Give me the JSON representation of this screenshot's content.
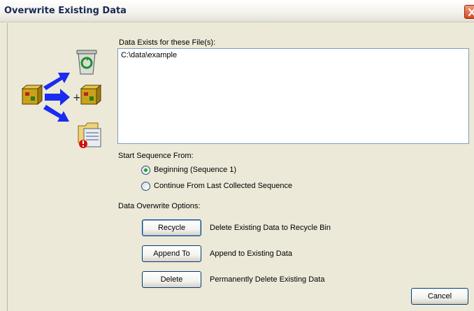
{
  "window": {
    "title": "Overwrite Existing Data"
  },
  "files": {
    "label": "Data Exists for these File(s):",
    "items": [
      "C:\\data\\example"
    ]
  },
  "sequence": {
    "label": "Start Sequence From:",
    "options": [
      {
        "label": "Beginning (Sequence 1)",
        "checked": true
      },
      {
        "label": "Continue From Last Collected Sequence",
        "checked": false
      }
    ]
  },
  "overwrite": {
    "label": "Data Overwrite Options:",
    "options": [
      {
        "button": "Recycle",
        "description": "Delete Existing Data to Recycle Bin"
      },
      {
        "button": "Append To",
        "description": "Append to Existing Data"
      },
      {
        "button": "Delete",
        "description": "Permanently Delete Existing Data"
      }
    ]
  },
  "footer": {
    "cancel_label": "Cancel"
  },
  "icons": {
    "plus": "+",
    "names": [
      "recycle-bin-icon",
      "data-cube-icon",
      "arrow-up-right-icon",
      "arrow-right-icon",
      "plus-icon",
      "data-cube-icon",
      "arrow-down-right-icon",
      "folder-warning-icon"
    ]
  },
  "colors": {
    "arrow": "#1a2cf0",
    "title_text": "#1b2a55",
    "radio_dot": "#21a121"
  }
}
